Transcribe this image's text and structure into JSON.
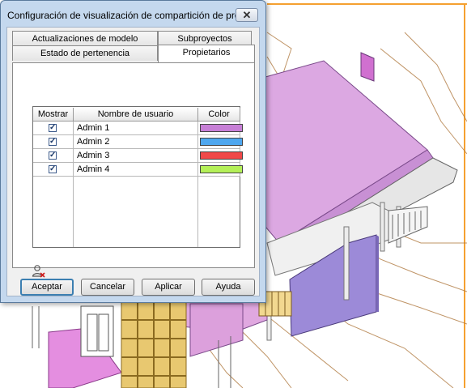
{
  "dialog": {
    "title": "Configuración de visualización de compartición de pro...",
    "close_label": "✕"
  },
  "tabs": {
    "row1": [
      "Actualizaciones de modelo",
      "Subproyectos"
    ],
    "row2": [
      "Estado de pertenencia",
      "Propietarios"
    ],
    "active": "Propietarios"
  },
  "table": {
    "headers": [
      "Mostrar",
      "Nombre de usuario",
      "Color"
    ],
    "rows": [
      {
        "checked": true,
        "name": "Admin 1",
        "color": "#c77fd6"
      },
      {
        "checked": true,
        "name": "Admin 2",
        "color": "#4ea7ef"
      },
      {
        "checked": true,
        "name": "Admin 3",
        "color": "#f04848"
      },
      {
        "checked": true,
        "name": "Admin 4",
        "color": "#b4f058"
      }
    ]
  },
  "icons": {
    "remove_user": "remove-user-icon"
  },
  "buttons": {
    "ok": "Aceptar",
    "cancel": "Cancelar",
    "apply": "Aplicar",
    "help": "Ayuda"
  },
  "colors": {
    "dialog_frame": "#c4d8ee",
    "background_line": "#f5a030",
    "model_pink": "#dca8e2"
  }
}
